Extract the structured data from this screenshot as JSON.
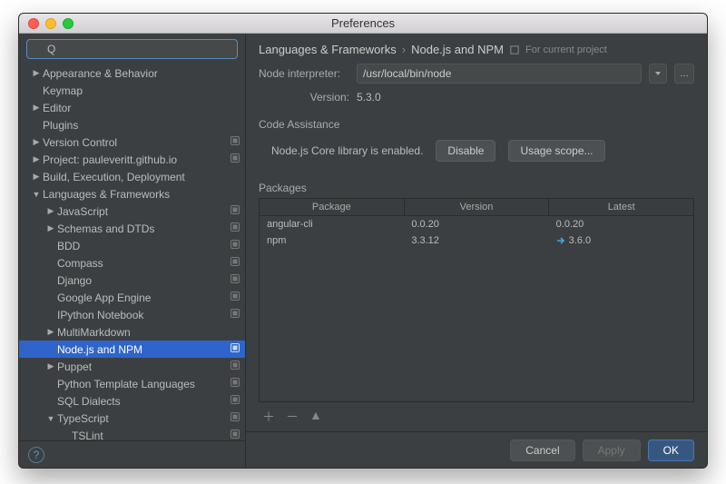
{
  "window": {
    "title": "Preferences"
  },
  "search": {
    "value": "",
    "placeholder": ""
  },
  "tree": [
    {
      "label": "Appearance & Behavior",
      "depth": 0,
      "arrow": "right"
    },
    {
      "label": "Keymap",
      "depth": 0,
      "arrow": "none"
    },
    {
      "label": "Editor",
      "depth": 0,
      "arrow": "right"
    },
    {
      "label": "Plugins",
      "depth": 0,
      "arrow": "none"
    },
    {
      "label": "Version Control",
      "depth": 0,
      "arrow": "right",
      "badge": true
    },
    {
      "label": "Project: pauleveritt.github.io",
      "depth": 0,
      "arrow": "right",
      "badge": true
    },
    {
      "label": "Build, Execution, Deployment",
      "depth": 0,
      "arrow": "right"
    },
    {
      "label": "Languages & Frameworks",
      "depth": 0,
      "arrow": "down"
    },
    {
      "label": "JavaScript",
      "depth": 1,
      "arrow": "right",
      "badge": true
    },
    {
      "label": "Schemas and DTDs",
      "depth": 1,
      "arrow": "right",
      "badge": true
    },
    {
      "label": "BDD",
      "depth": 1,
      "arrow": "none",
      "badge": true
    },
    {
      "label": "Compass",
      "depth": 1,
      "arrow": "none",
      "badge": true
    },
    {
      "label": "Django",
      "depth": 1,
      "arrow": "none",
      "badge": true
    },
    {
      "label": "Google App Engine",
      "depth": 1,
      "arrow": "none",
      "badge": true
    },
    {
      "label": "IPython Notebook",
      "depth": 1,
      "arrow": "none",
      "badge": true
    },
    {
      "label": "MultiMarkdown",
      "depth": 1,
      "arrow": "right"
    },
    {
      "label": "Node.js and NPM",
      "depth": 1,
      "arrow": "none",
      "badge": true,
      "selected": true
    },
    {
      "label": "Puppet",
      "depth": 1,
      "arrow": "right",
      "badge": true
    },
    {
      "label": "Python Template Languages",
      "depth": 1,
      "arrow": "none",
      "badge": true
    },
    {
      "label": "SQL Dialects",
      "depth": 1,
      "arrow": "none",
      "badge": true
    },
    {
      "label": "TypeScript",
      "depth": 1,
      "arrow": "down",
      "badge": true
    },
    {
      "label": "TSLint",
      "depth": 2,
      "arrow": "none",
      "badge": true
    }
  ],
  "breadcrumb": {
    "parent": "Languages & Frameworks",
    "current": "Node.js and NPM",
    "scope": "For current project"
  },
  "interpreter": {
    "label": "Node interpreter:",
    "path": "/usr/local/bin/node",
    "version_label": "Version:",
    "version": "5.3.0"
  },
  "assistance": {
    "title": "Code Assistance",
    "status": "Node.js Core library is enabled.",
    "disable_label": "Disable",
    "scope_label": "Usage scope..."
  },
  "packages": {
    "title": "Packages",
    "cols": [
      "Package",
      "Version",
      "Latest"
    ],
    "rows": [
      {
        "name": "angular-cli",
        "version": "0.0.20",
        "latest": "0.0.20",
        "update": false
      },
      {
        "name": "npm",
        "version": "3.3.12",
        "latest": "3.6.0",
        "update": true
      }
    ]
  },
  "footer": {
    "cancel": "Cancel",
    "apply": "Apply",
    "ok": "OK"
  }
}
